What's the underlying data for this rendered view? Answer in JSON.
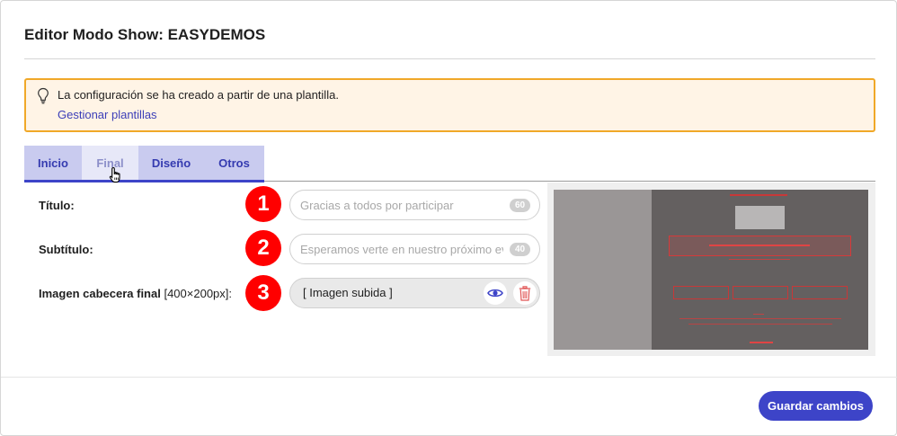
{
  "modal": {
    "title": "Editor Modo Show: EASYDEMOS"
  },
  "alert": {
    "icon": "lightbulb-icon",
    "message": "La configuración se ha creado a partir de una plantilla.",
    "link": "Gestionar plantillas",
    "border_color": "#f0a828",
    "background_color": "#fff4e6"
  },
  "tabs": [
    {
      "label": "Inicio",
      "active": false
    },
    {
      "label": "Final",
      "active": true
    },
    {
      "label": "Diseño",
      "active": false
    },
    {
      "label": "Otros",
      "active": false
    }
  ],
  "form": {
    "rows": [
      {
        "badge": "1",
        "label": "Título:",
        "placeholder": "Gracias a todos por participar",
        "counter": "60"
      },
      {
        "badge": "2",
        "label": "Subtítulo:",
        "placeholder": "Esperamos verte en nuestro próximo evento",
        "counter": "40"
      },
      {
        "badge": "3",
        "label": "Imagen cabecera final",
        "label_suffix": "[400×200px]:",
        "value": "[ Imagen subida ]"
      }
    ]
  },
  "footer": {
    "save_label": "Guardar cambios"
  },
  "colors": {
    "accent": "#3d44c8",
    "badge": "#ff0000",
    "tab_bar": "#c9cbef"
  }
}
